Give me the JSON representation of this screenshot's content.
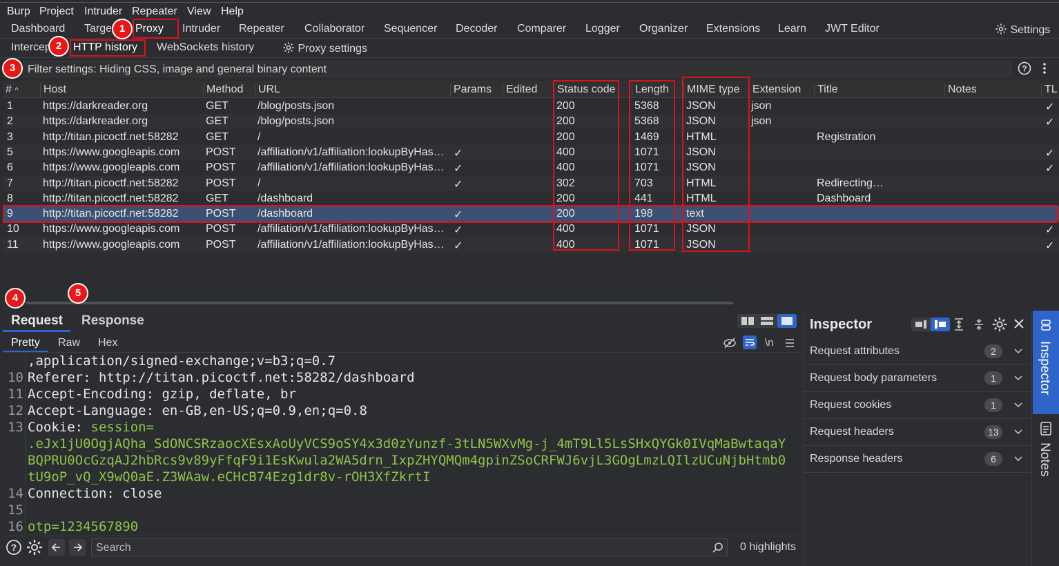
{
  "menubar": [
    "Burp",
    "Project",
    "Intruder",
    "Repeater",
    "View",
    "Help"
  ],
  "main_tabs": [
    "Dashboard",
    "Target",
    "Proxy",
    "Intruder",
    "Repeater",
    "Collaborator",
    "Sequencer",
    "Decoder",
    "Comparer",
    "Logger",
    "Organizer",
    "Extensions",
    "Learn",
    "JWT Editor"
  ],
  "settings_label": "Settings",
  "proxy_tabs": [
    "Intercept",
    "HTTP history",
    "WebSockets history",
    "Proxy settings"
  ],
  "filter_text": "Filter settings: Hiding CSS, image and general binary content",
  "columns": [
    "#",
    "Host",
    "Method",
    "URL",
    "Params",
    "Edited",
    "Status code",
    "Length",
    "MIME type",
    "Extension",
    "Title",
    "Notes",
    "TL"
  ],
  "rows": [
    {
      "id": "1",
      "host": "https://darkreader.org",
      "method": "GET",
      "url": "/blog/posts.json",
      "params": "",
      "status": "200",
      "length": "5368",
      "mime": "JSON",
      "ext": "json",
      "title": "",
      "tls": "✓"
    },
    {
      "id": "2",
      "host": "https://darkreader.org",
      "method": "GET",
      "url": "/blog/posts.json",
      "params": "",
      "status": "200",
      "length": "5368",
      "mime": "JSON",
      "ext": "json",
      "title": "",
      "tls": "✓"
    },
    {
      "id": "3",
      "host": "http://titan.picoctf.net:58282",
      "method": "GET",
      "url": "/",
      "params": "",
      "status": "200",
      "length": "1469",
      "mime": "HTML",
      "ext": "",
      "title": "Registration",
      "tls": ""
    },
    {
      "id": "5",
      "host": "https://www.googleapis.com",
      "method": "POST",
      "url": "/affiliation/v1/affiliation:lookupByHas…",
      "params": "✓",
      "status": "400",
      "length": "1071",
      "mime": "JSON",
      "ext": "",
      "title": "",
      "tls": "✓"
    },
    {
      "id": "6",
      "host": "https://www.googleapis.com",
      "method": "POST",
      "url": "/affiliation/v1/affiliation:lookupByHas…",
      "params": "✓",
      "status": "400",
      "length": "1071",
      "mime": "JSON",
      "ext": "",
      "title": "",
      "tls": "✓"
    },
    {
      "id": "7",
      "host": "http://titan.picoctf.net:58282",
      "method": "POST",
      "url": "/",
      "params": "✓",
      "status": "302",
      "length": "703",
      "mime": "HTML",
      "ext": "",
      "title": "Redirecting…",
      "tls": ""
    },
    {
      "id": "8",
      "host": "http://titan.picoctf.net:58282",
      "method": "GET",
      "url": "/dashboard",
      "params": "",
      "status": "200",
      "length": "441",
      "mime": "HTML",
      "ext": "",
      "title": "Dashboard",
      "tls": ""
    },
    {
      "id": "9",
      "host": "http://titan.picoctf.net:58282",
      "method": "POST",
      "url": "/dashboard",
      "params": "✓",
      "status": "200",
      "length": "198",
      "mime": "text",
      "ext": "",
      "title": "",
      "tls": ""
    },
    {
      "id": "10",
      "host": "https://www.googleapis.com",
      "method": "POST",
      "url": "/affiliation/v1/affiliation:lookupByHas…",
      "params": "✓",
      "status": "400",
      "length": "1071",
      "mime": "JSON",
      "ext": "",
      "title": "",
      "tls": "✓"
    },
    {
      "id": "11",
      "host": "https://www.googleapis.com",
      "method": "POST",
      "url": "/affiliation/v1/affiliation:lookupByHas…",
      "params": "✓",
      "status": "400",
      "length": "1071",
      "mime": "JSON",
      "ext": "",
      "title": "",
      "tls": "✓"
    }
  ],
  "selected_row": "9",
  "message_tabs": [
    "Request",
    "Response"
  ],
  "view_tabs": [
    "Pretty",
    "Raw",
    "Hex"
  ],
  "newline_label": "\\n",
  "editor_lines": [
    {
      "n": "",
      "key": ",application/signed-exchange;v=b3;q=0.7",
      "val": ""
    },
    {
      "n": "10",
      "key": "Referer:",
      "val": " http://titan.picoctf.net:58282/dashboard"
    },
    {
      "n": "11",
      "key": "Accept-Encoding:",
      "val": " gzip, deflate, br"
    },
    {
      "n": "12",
      "key": "Accept-Language:",
      "val": " en-GB,en-US;q=0.9,en;q=0.8"
    },
    {
      "n": "13",
      "key": "Cookie:",
      "val": " session="
    },
    {
      "n": "",
      "key": "",
      "val": ".eJx1jU0OgjAQha_SdONCSRzaocXEsxAoUyVCS9oSY4x3d0zYunzf-3tLN5WXvMg-j_4mT9Ll5LsSHxQYGk0IVqMaBwtaqaY"
    },
    {
      "n": "",
      "key": "",
      "val": "BQPRU0OcGzqAJ2hbRcs9v89yFfqF9i1EsKwula2WA5drn_IxpZHYQMQm4gpinZSoCRFWJ6vjL3GOgLmzLQIlzUCuNjbHtmb0"
    },
    {
      "n": "",
      "key": "",
      "val": "tU9oP_vQ_X9wQ0aE.Z3WAaw.eCHcB74Ezg1dr8v-rOH3XfZkrtI"
    },
    {
      "n": "14",
      "key": "Connection:",
      "val": " close"
    },
    {
      "n": "15",
      "key": "",
      "val": ""
    },
    {
      "n": "16",
      "key": "otp",
      "val": "=1234567890"
    }
  ],
  "search_placeholder": "Search",
  "highlights": "0 highlights",
  "inspector": {
    "title": "Inspector",
    "sections": [
      {
        "label": "Request attributes",
        "count": "2"
      },
      {
        "label": "Request body parameters",
        "count": "1"
      },
      {
        "label": "Request cookies",
        "count": "1"
      },
      {
        "label": "Request headers",
        "count": "13"
      },
      {
        "label": "Response headers",
        "count": "6"
      }
    ]
  },
  "side_tabs": [
    "Inspector",
    "Notes"
  ],
  "annotations": [
    "1",
    "2",
    "3",
    "4",
    "5"
  ],
  "colors": {
    "annotation": "#e0101a",
    "selected_row": "#3d4f72",
    "accent": "#2f65ca",
    "cookie_value": "#8cc44a"
  }
}
